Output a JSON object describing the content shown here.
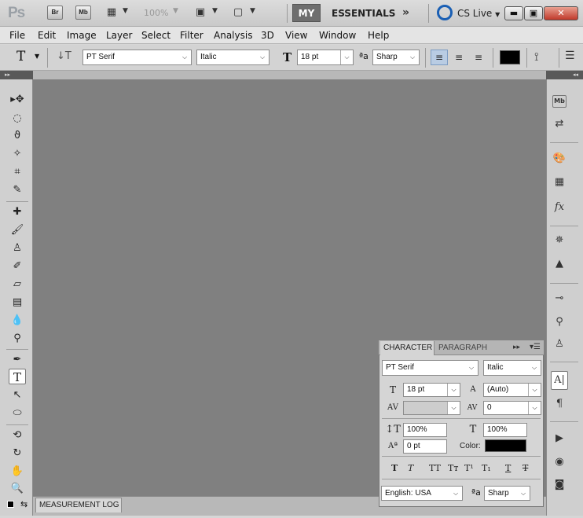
{
  "titlebar": {
    "logo": "Ps",
    "bridge": "Br",
    "minibridge": "Mb",
    "zoom": "100%",
    "workspace_active": "MY",
    "workspace_essentials": "ESSENTIALS",
    "more": "»",
    "cslive": "CS Live"
  },
  "menu": [
    "File",
    "Edit",
    "Image",
    "Layer",
    "Select",
    "Filter",
    "Analysis",
    "3D",
    "View",
    "Window",
    "Help"
  ],
  "options": {
    "font_family": "PT Serif",
    "font_style": "Italic",
    "font_size": "18 pt",
    "antialias": "Sharp"
  },
  "character": {
    "tab_character": "CHARACTER",
    "tab_paragraph": "PARAGRAPH",
    "font_family": "PT Serif",
    "font_style": "Italic",
    "font_size": "18 pt",
    "leading": "(Auto)",
    "kerning": "",
    "tracking": "0",
    "vertical_scale": "100%",
    "horizontal_scale": "100%",
    "baseline_shift": "0 pt",
    "color_label": "Color:",
    "color": "#000000",
    "language": "English: USA",
    "antialias": "Sharp",
    "aa_symbol": "ªa"
  },
  "bottom": {
    "measurement_log": "MEASUREMENT LOG"
  },
  "colors": {
    "canvas": "#808080",
    "text_color": "#000000"
  }
}
